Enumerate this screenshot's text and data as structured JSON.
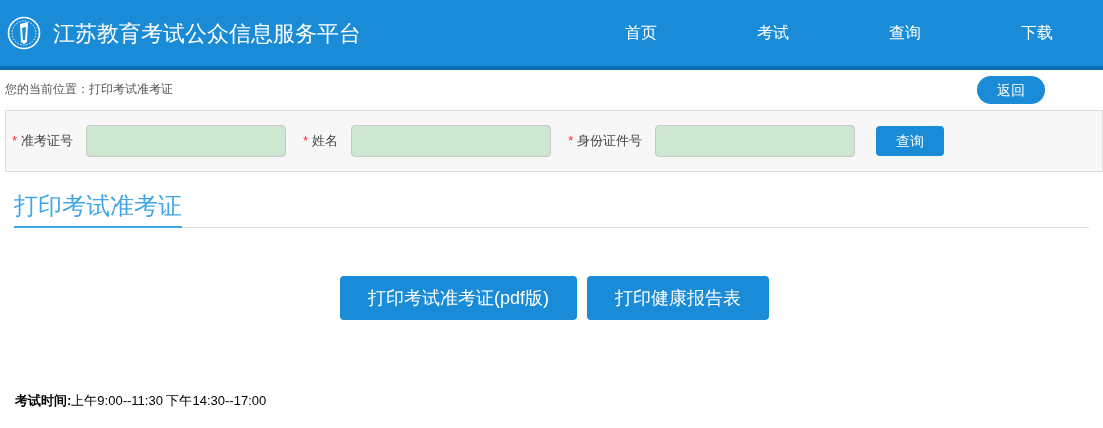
{
  "header": {
    "title": "江苏教育考试公众信息服务平台",
    "nav": [
      "首页",
      "考试",
      "查询",
      "下载"
    ]
  },
  "breadcrumb": "您的当前位置：打印考试准考证",
  "back_button": "返回",
  "form": {
    "fields": [
      {
        "label": "准考证号",
        "required": true
      },
      {
        "label": "姓名",
        "required": true
      },
      {
        "label": "身份证件号",
        "required": true
      }
    ],
    "required_mark": "*",
    "submit": "查询"
  },
  "section_title": "打印考试准考证",
  "actions": [
    "打印考试准考证(pdf版)",
    "打印健康报告表"
  ],
  "note": "**考试时间:**上午9:00--11:30 下午14:30--17:00"
}
